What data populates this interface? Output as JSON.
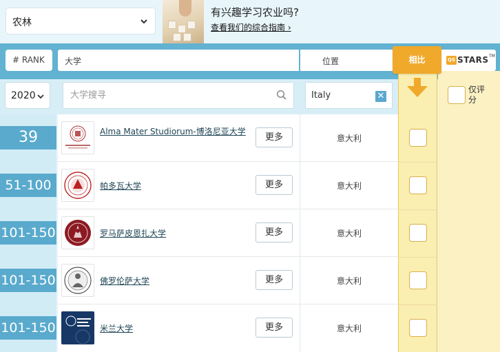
{
  "filters": {
    "subject": "农林",
    "year": "2020",
    "search_placeholder": "大学搜寻",
    "location": "Italy",
    "only_rated_label": "仅评分",
    "clear_icon": "close-icon"
  },
  "promo": {
    "question": "有兴趣学习农业吗?",
    "link": "查看我们的综合指南 ›"
  },
  "header": {
    "rank": "# RANK",
    "university": "大学",
    "location": "位置",
    "compare": "相比",
    "qs_logo": "QS",
    "stars": "STARS",
    "stars_tm": "TM"
  },
  "colors": {
    "accent_blue": "#59aacd",
    "header_band": "#62b2d1",
    "compare_orange": "#f0a92a",
    "compare_column": "#fbeeb1"
  },
  "rows": [
    {
      "rank": "39",
      "name": "Alma Mater Studiorum-博洛尼亚大学",
      "more": "更多",
      "location": "意大利",
      "logo": "university-of-bologna-logo"
    },
    {
      "rank": "51-100",
      "name": "帕多瓦大学",
      "more": "更多",
      "location": "意大利",
      "logo": "university-of-padua-logo"
    },
    {
      "rank": "101-150",
      "name": "罗马萨皮恩扎大学",
      "more": "更多",
      "location": "意大利",
      "logo": "sapienza-logo"
    },
    {
      "rank": "101-150",
      "name": "佛罗伦萨大学",
      "more": "更多",
      "location": "意大利",
      "logo": "university-of-florence-logo"
    },
    {
      "rank": "101-150",
      "name": "米兰大学",
      "more": "更多",
      "location": "意大利",
      "logo": "university-of-milan-logo"
    }
  ]
}
